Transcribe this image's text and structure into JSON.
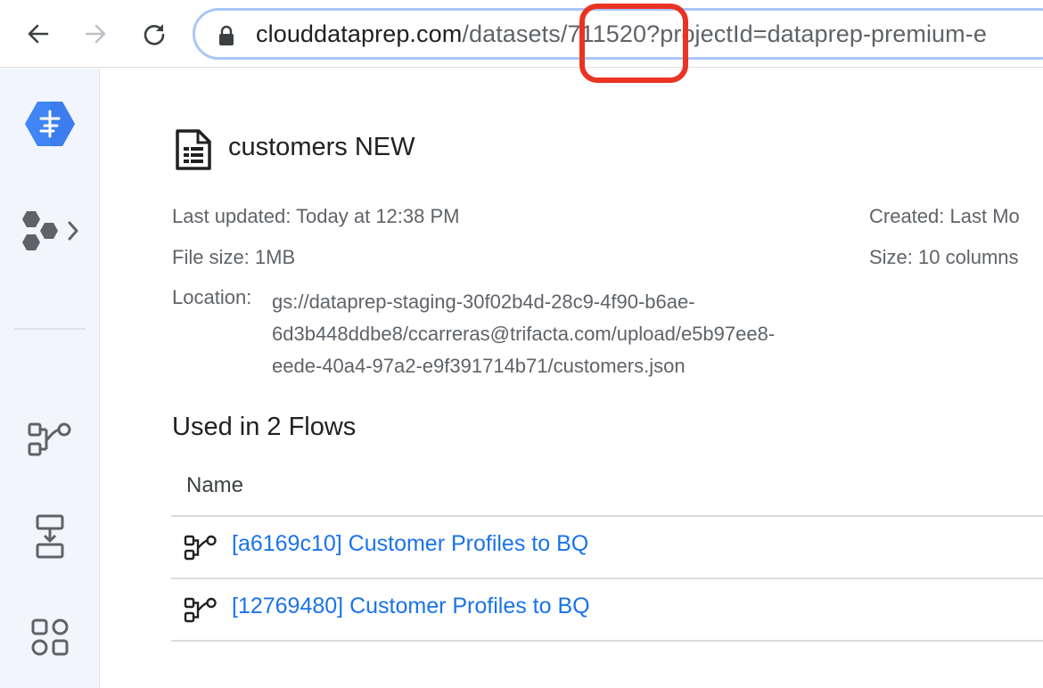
{
  "browser": {
    "url_host": "clouddataprep.com",
    "url_rest": "/datasets/711520?projectId=dataprep-premium-e"
  },
  "rail": {
    "items": [
      {
        "icon": "dataprep-logo-icon"
      },
      {
        "icon": "hexagon-cluster-icon"
      },
      {
        "icon": "flow-icon"
      },
      {
        "icon": "job-download-icon"
      },
      {
        "icon": "apps-grid-icon"
      }
    ]
  },
  "dataset": {
    "title": "customers NEW",
    "last_updated": "Last updated: Today at 12:38 PM",
    "file_size": "File size: 1MB",
    "created": "Created: Last Mo",
    "size": "Size: 10 columns",
    "location_label": "Location:",
    "location_line1": "gs://dataprep-staging-30f02b4d-28c9-4f90-b6ae-",
    "location_line2": "6d3b448ddbe8/ccarreras@trifacta.com/upload/e5b97ee8-",
    "location_line3": "eede-40a4-97a2-e9f391714b71/customers.json"
  },
  "flows": {
    "heading": "Used in 2 Flows",
    "column_name": "Name",
    "rows": [
      {
        "name": "[a6169c10] Customer Profiles to BQ"
      },
      {
        "name": "[12769480] Customer Profiles to BQ"
      }
    ]
  },
  "colors": {
    "link": "#1a73e8",
    "highlight": "#ea3323",
    "logo": "#4285f4"
  }
}
